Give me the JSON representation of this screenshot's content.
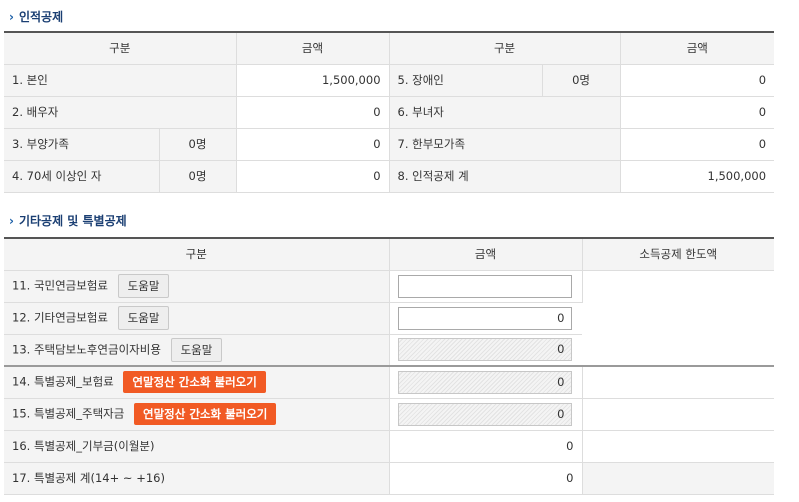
{
  "section1": {
    "title": "인적공제",
    "headers": {
      "col1": "구분",
      "col2": "금액",
      "col3": "구분",
      "col4": "금액"
    },
    "rows": [
      {
        "left_label": "1. 본인",
        "left_count": "",
        "left_amount": "1,500,000",
        "right_label": "5. 장애인",
        "right_count": "0명",
        "right_amount": "0"
      },
      {
        "left_label": "2. 배우자",
        "left_count": "",
        "left_amount": "0",
        "right_label": "6. 부녀자",
        "right_count": "",
        "right_amount": "0"
      },
      {
        "left_label": "3. 부양가족",
        "left_count": "0명",
        "left_amount": "0",
        "right_label": "7. 한부모가족",
        "right_count": "",
        "right_amount": "0"
      },
      {
        "left_label": "4. 70세 이상인 자",
        "left_count": "0명",
        "left_amount": "0",
        "right_label": "8. 인적공제 계",
        "right_count": "",
        "right_amount": "1,500,000"
      }
    ]
  },
  "section2": {
    "title": "기타공제 및 특별공제",
    "headers": {
      "col1": "구분",
      "col2": "금액",
      "col3": "소득공제 한도액"
    },
    "rows": [
      {
        "label": "11. 국민연금보험료",
        "button": "도움말",
        "value": ""
      },
      {
        "label": "12. 기타연금보험료",
        "button": "도움말",
        "value": "0"
      },
      {
        "label": "13. 주택담보노후연금이자비용",
        "button": "도움말",
        "value": "0"
      },
      {
        "label": "14. 특별공제_보험료",
        "button": "연말정산 간소화 불러오기",
        "value": "0"
      },
      {
        "label": "15. 특별공제_주택자금",
        "button": "연말정산 간소화 불러오기",
        "value": "0"
      },
      {
        "label": "16. 특별공제_기부금(이월분)",
        "value": "0"
      },
      {
        "label": "17. 특별공제 계(14+ ~ +16)",
        "value": "0"
      }
    ]
  },
  "colors": {
    "title": "#1b3f73",
    "accent_button": "#f15a24",
    "header_bg": "#f4f4f4"
  }
}
